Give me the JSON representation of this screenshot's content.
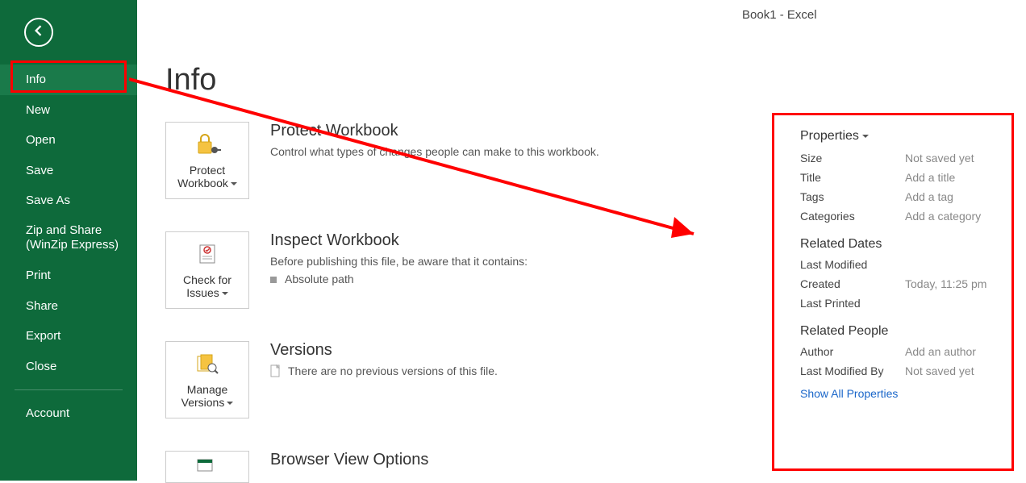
{
  "app_title": "Book1 - Excel",
  "sidebar": {
    "items": [
      {
        "label": "Info",
        "selected": true
      },
      {
        "label": "New"
      },
      {
        "label": "Open"
      },
      {
        "label": "Save"
      },
      {
        "label": "Save As"
      },
      {
        "label": "Zip and Share\n(WinZip Express)",
        "multiline": true
      },
      {
        "label": "Print"
      },
      {
        "label": "Share"
      },
      {
        "label": "Export"
      },
      {
        "label": "Close"
      }
    ],
    "footer_items": [
      {
        "label": "Account"
      }
    ]
  },
  "page_heading": "Info",
  "sections": {
    "protect": {
      "tile_label1": "Protect",
      "tile_label2": "Workbook",
      "title": "Protect Workbook",
      "desc": "Control what types of changes people can make to this workbook."
    },
    "inspect": {
      "tile_label1": "Check for",
      "tile_label2": "Issues",
      "title": "Inspect Workbook",
      "desc": "Before publishing this file, be aware that it contains:",
      "bullet": "Absolute path"
    },
    "versions": {
      "tile_label1": "Manage",
      "tile_label2": "Versions",
      "title": "Versions",
      "desc": "There are no previous versions of this file."
    },
    "browser": {
      "title": "Browser View Options"
    }
  },
  "properties": {
    "heading": "Properties",
    "rows": [
      {
        "label": "Size",
        "value": "Not saved yet"
      },
      {
        "label": "Title",
        "value": "Add a title"
      },
      {
        "label": "Tags",
        "value": "Add a tag"
      },
      {
        "label": "Categories",
        "value": "Add a category"
      }
    ],
    "related_dates_heading": "Related Dates",
    "dates": [
      {
        "label": "Last Modified",
        "value": ""
      },
      {
        "label": "Created",
        "value": "Today, 11:25 pm"
      },
      {
        "label": "Last Printed",
        "value": ""
      }
    ],
    "related_people_heading": "Related People",
    "people": [
      {
        "label": "Author",
        "value": "Add an author"
      },
      {
        "label": "Last Modified By",
        "value": "Not saved yet"
      }
    ],
    "show_all": "Show All Properties"
  }
}
